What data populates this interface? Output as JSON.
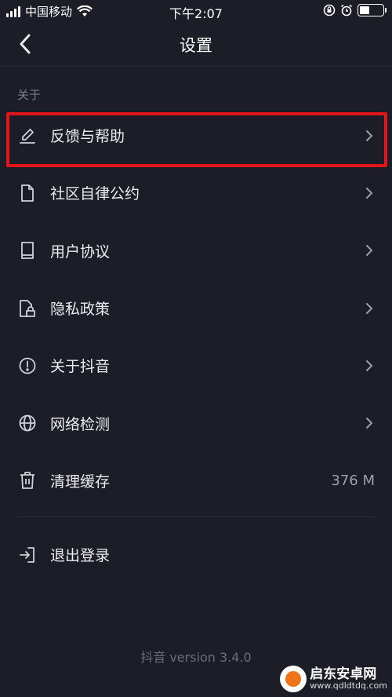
{
  "status_bar": {
    "carrier": "中国移动",
    "time": "下午2:07",
    "battery_level": 0.45
  },
  "nav": {
    "title": "设置",
    "back_icon": "chevron-left-icon"
  },
  "section": {
    "label": "关于"
  },
  "menu": {
    "items": [
      {
        "label": "反馈与帮助",
        "icon": "edit-icon",
        "highlighted": true
      },
      {
        "label": "社区自律公约",
        "icon": "document-icon"
      },
      {
        "label": "用户协议",
        "icon": "book-icon"
      },
      {
        "label": "隐私政策",
        "icon": "privacy-lock-icon"
      },
      {
        "label": "关于抖音",
        "icon": "info-icon"
      },
      {
        "label": "网络检测",
        "icon": "globe-icon"
      },
      {
        "label": "清理缓存",
        "icon": "trash-icon",
        "value": "376 M"
      }
    ],
    "logout": {
      "label": "退出登录",
      "icon": "logout-icon"
    }
  },
  "footer": {
    "version": "抖音 version 3.4.0"
  },
  "watermark": {
    "title": "启东安卓网",
    "url": "www.qdldtdq.com"
  },
  "colors": {
    "background": "#1c1d27",
    "highlight_border": "#e0161b",
    "text_primary": "#ececf0",
    "text_secondary": "#7c7d88"
  }
}
